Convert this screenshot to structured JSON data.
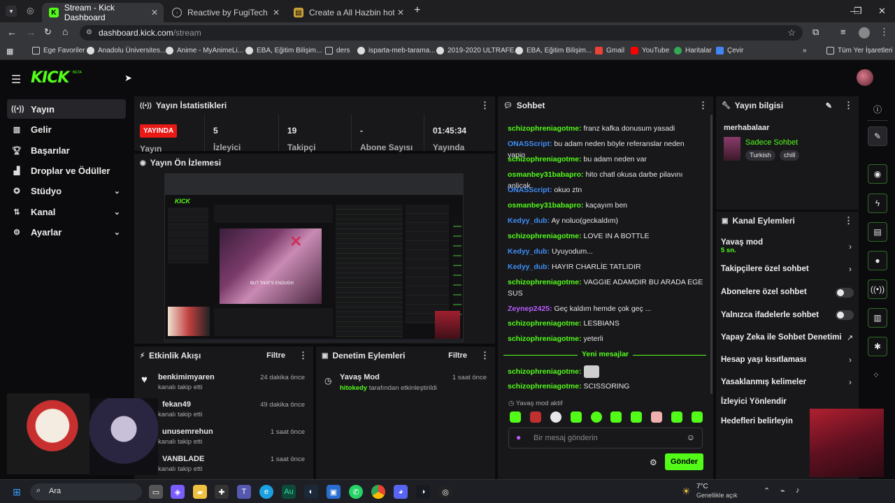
{
  "browser": {
    "tabs": [
      {
        "label": "Stream - Kick Dashboard",
        "active": true
      },
      {
        "label": "Reactive by FugiTech"
      },
      {
        "label": "Create a All Hazbin hotel seaso"
      }
    ],
    "url_host": "dashboard.kick.com",
    "url_path": "/stream",
    "bookmarks": [
      "Ege Favoriler",
      "Anadolu Üniversites...",
      "Anime - MyAnimeLi...",
      "EBA, Eğitim Bilişim...",
      "ders",
      "isparta-meb-tarama...",
      "2019-2020 ULTRAFE...",
      "EBA, Eğitim Bilişim...",
      "Gmail",
      "YouTube",
      "Haritalar",
      "Çevir"
    ],
    "all_bookmarks": "Tüm Yer İşaretleri"
  },
  "brand": {
    "logo": "KICK",
    "beta": "BETA",
    "accent": "#53fc18"
  },
  "nav": [
    {
      "label": "Yayın",
      "icon": "broadcast-icon"
    },
    {
      "label": "Gelir",
      "icon": "chart-icon"
    },
    {
      "label": "Başarılar",
      "icon": "trophy-icon"
    },
    {
      "label": "Droplar ve Ödüller",
      "icon": "gift-icon"
    },
    {
      "label": "Stüdyo",
      "icon": "studio-icon"
    },
    {
      "label": "Kanal",
      "icon": "channel-icon"
    },
    {
      "label": "Ayarlar",
      "icon": "gear-icon"
    }
  ],
  "stats": {
    "title": "Yayın İstatistikleri",
    "live_badge": "YAYINDA",
    "status_label": "Yayın",
    "viewers": "5",
    "viewers_label": "İzleyici",
    "followers": "19",
    "followers_label": "Takipçi",
    "subs": "-",
    "subs_label": "Abone Sayısı",
    "uptime": "01:45:34",
    "uptime_label": "Yayında Olduğu"
  },
  "preview": {
    "title": "Yayın Ön İzlemesi",
    "caption": "BUT THAT'S ENOUGH"
  },
  "activity": {
    "title": "Etkinlik Akışı",
    "filter": "Filtre",
    "items": [
      {
        "user": "benkimimyaren",
        "sub": "kanalı takip etti",
        "time": "24 dakika önce"
      },
      {
        "user": "fekan49",
        "sub": "kanalı takip etti",
        "time": "49 dakika önce"
      },
      {
        "user": "unusemrehun",
        "sub": "kanalı takip etti",
        "time": "1 saat önce"
      },
      {
        "user": "VANBLADE",
        "sub": "kanalı takip etti",
        "time": "1 saat önce"
      }
    ]
  },
  "moderation": {
    "title": "Denetim Eylemleri",
    "filter": "Filtre",
    "item": {
      "title": "Yavaş Mod",
      "actor": "hitokedy",
      "text": "tarafından etkinleştirildi",
      "time": "1 saat önce"
    }
  },
  "chat": {
    "title": "Sohbet",
    "messages": [
      {
        "user": "schizophreniagotme:",
        "color": "g",
        "text": "franz kafka donusum yasadi"
      },
      {
        "user": "ONASScript:",
        "color": "b",
        "text": "bu adam neden böyle referanslar neden yapio"
      },
      {
        "user": "schizophreniagotme:",
        "color": "g",
        "text": "bu adam neden var"
      },
      {
        "user": "osmanbey31babapro:",
        "color": "g",
        "text": "hito chatl okusa darbe pilavını anlicak"
      },
      {
        "user": "ONASScript:",
        "color": "b",
        "text": "okuo ztn"
      },
      {
        "user": "osmanbey31babapro:",
        "color": "g",
        "text": "kaçayım ben"
      },
      {
        "user": "Kedyy_dub:",
        "color": "b",
        "text": "Ay noluo(geckaldım)"
      },
      {
        "user": "schizophreniagotme:",
        "color": "g",
        "text": "LOVE IN A BOTTLE"
      },
      {
        "user": "Kedyy_dub:",
        "color": "b",
        "text": "Uyuyodum..."
      },
      {
        "user": "Kedyy_dub:",
        "color": "b",
        "text": "HAYIR CHARLİE TATLIDIR"
      },
      {
        "user": "schizophreniagotme:",
        "color": "g",
        "text": "VAGGIE ADAMDIR BU ARADA EGE SUS"
      },
      {
        "user": "Zeynep2425:",
        "color": "p",
        "text": "Geç kaldım hemde çok geç ..."
      },
      {
        "user": "schizophreniagotme:",
        "color": "g",
        "text": "LESBIANS"
      },
      {
        "user": "schizophreniagotme:",
        "color": "g",
        "text": "yeterli"
      }
    ],
    "new_messages": "Yeni mesajlar",
    "after": [
      {
        "user": "schizophreniagotme:",
        "color": "g",
        "text": ""
      },
      {
        "user": "schizophreniagotme:",
        "color": "g",
        "text": "SCISSORING"
      }
    ],
    "slow_mode": "Yavaş mod aktif",
    "placeholder": "Bir mesaj gönderin",
    "send": "Gönder"
  },
  "info": {
    "title": "Yayın bilgisi",
    "stream_title": "merhabalaar",
    "category": "Sadece Sohbet",
    "tags": [
      "Turkish",
      "chill"
    ]
  },
  "channel_actions": {
    "title": "Kanal Eylemleri",
    "slow_mode": "Yavaş mod",
    "slow_value": "5 sn.",
    "items": [
      "Takipçilere özel sohbet",
      "Abonelere özel sohbet",
      "Yalnızca ifadelerle sohbet",
      "Yapay Zeka ile Sohbet Denetimi",
      "Hesap yaşı kısıtlaması",
      "Yasaklanmış kelimeler",
      "İzleyici Yönlendir",
      "Hedefleri belirleyin"
    ]
  },
  "taskbar": {
    "search": "Ara",
    "temp": "7°C",
    "weather": "Genellikle açık"
  }
}
